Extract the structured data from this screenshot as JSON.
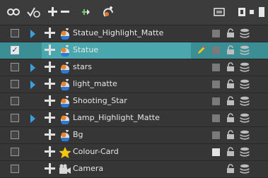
{
  "toolbar": {
    "icons": [
      "show-all-icon",
      "enable-all-icon",
      "add-layer-icon",
      "delete-layer-icon",
      "add-peg-icon",
      "add-drawing-icon",
      "camera-view-icon",
      "selected-view-icon",
      "layer-dot-icon",
      "layer-bar-icon"
    ]
  },
  "layers": [
    {
      "name": "Statue_Highlight_Matte",
      "expandable": true,
      "checked": false,
      "selected": false,
      "icon": "drawing-layer-icon",
      "colour_swatch": "#7a7a7a"
    },
    {
      "name": "Statue",
      "expandable": false,
      "checked": true,
      "selected": true,
      "icon": "drawing-layer-icon",
      "editing": true,
      "colour_swatch": "#7a7a7a"
    },
    {
      "name": "stars",
      "expandable": true,
      "checked": false,
      "selected": false,
      "icon": "drawing-layer-icon",
      "colour_swatch": "#7a7a7a"
    },
    {
      "name": "light_matte",
      "expandable": true,
      "checked": false,
      "selected": false,
      "icon": "drawing-layer-icon",
      "colour_swatch": "#7a7a7a"
    },
    {
      "name": "Shooting_Star",
      "expandable": false,
      "checked": false,
      "selected": false,
      "icon": "drawing-layer-icon",
      "colour_swatch": "#7a7a7a"
    },
    {
      "name": "Lamp_Highlight_Matte",
      "expandable": true,
      "checked": false,
      "selected": false,
      "icon": "drawing-layer-icon",
      "colour_swatch": "#7a7a7a"
    },
    {
      "name": "Bg",
      "expandable": false,
      "checked": false,
      "selected": false,
      "icon": "drawing-layer-icon",
      "colour_swatch": "#7a7a7a"
    },
    {
      "name": "Colour-Card",
      "expandable": false,
      "checked": false,
      "selected": false,
      "icon": "colour-card-star-icon",
      "colour_swatch": "#e2e2e2"
    },
    {
      "name": "Camera",
      "expandable": false,
      "checked": false,
      "selected": false,
      "icon": "camera-layer-icon",
      "colour_swatch": null
    }
  ],
  "colors": {
    "accent": "#3c8e95",
    "expand_arrow": "#3aa0e0"
  }
}
